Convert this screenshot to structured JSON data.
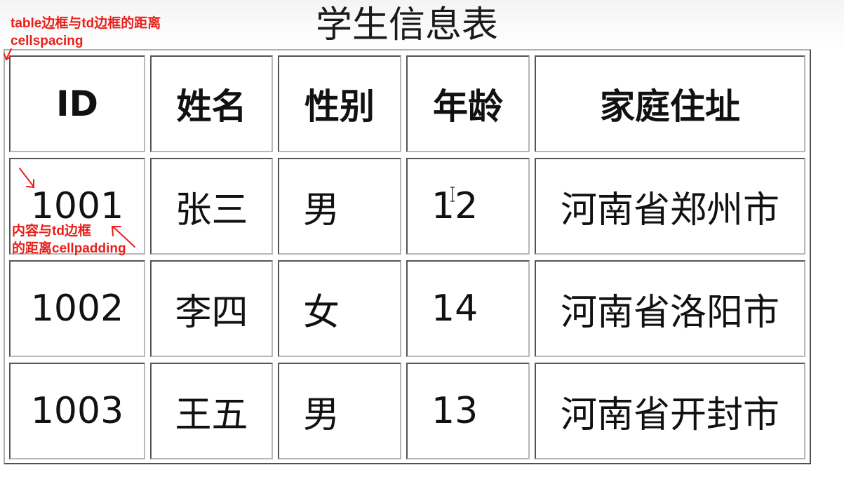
{
  "page": {
    "title": "学生信息表"
  },
  "table": {
    "headers": [
      "ID",
      "姓名",
      "性别",
      "年龄",
      "家庭住址"
    ],
    "rows": [
      [
        "1001",
        "张三",
        "男",
        "12",
        "河南省郑州市"
      ],
      [
        "1002",
        "李四",
        "女",
        "14",
        "河南省洛阳市"
      ],
      [
        "1003",
        "王五",
        "男",
        "13",
        "河南省开封市"
      ]
    ]
  },
  "annotations": {
    "cellspacing_line1": "table边框与td边框的距离",
    "cellspacing_line2": "cellspacing",
    "cellpadding_line1": "内容与td边框",
    "cellpadding_line2": "的距离cellpadding"
  },
  "colors": {
    "annotation": "#e8201a",
    "border_dark": "#555555",
    "border_light": "#b8b8b8"
  },
  "icons": {
    "cursor": "text-cursor-icon",
    "arrow_cellspacing": "arrow-icon",
    "arrow_cellpadding_a": "arrow-icon",
    "arrow_cellpadding_b": "arrow-icon"
  }
}
